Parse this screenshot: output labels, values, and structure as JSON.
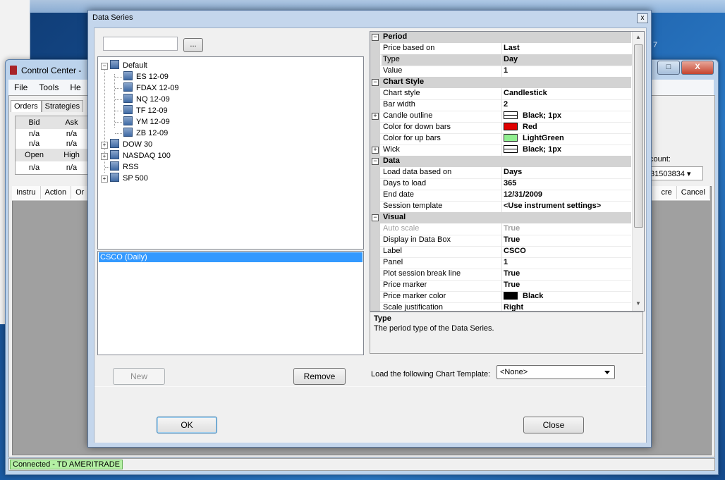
{
  "desktop": {
    "corner_text": "7"
  },
  "control_center": {
    "title": "Control Center -",
    "window_buttons": {
      "min": "–",
      "max": "□",
      "close": "X"
    },
    "menu": [
      "File",
      "Tools",
      "He"
    ],
    "tabs": [
      "Orders",
      "Strategies"
    ],
    "quote_headers_1": [
      "Bid",
      "Ask"
    ],
    "quote_values_1a": [
      "n/a",
      "n/a"
    ],
    "quote_values_1b": [
      "n/a",
      "n/a"
    ],
    "quote_headers_2": [
      "Open",
      "High"
    ],
    "quote_values_2": [
      "n/a",
      "n/a"
    ],
    "order_columns_left": [
      "Instru",
      "Action",
      "Or"
    ],
    "order_columns_right": [
      "cre",
      "Cancel"
    ],
    "account_label": "count:",
    "account_value": "31503834",
    "status": "Connected - TD AMERITRADE"
  },
  "dialog": {
    "title": "Data Series",
    "close": "x",
    "browse_label": "...",
    "tree": {
      "default_group": "Default",
      "default_children": [
        "ES 12-09",
        "FDAX 12-09",
        "NQ 12-09",
        "TF 12-09",
        "YM 12-09",
        "ZB 12-09"
      ],
      "groups": [
        "DOW 30",
        "NASDAQ 100",
        "RSS",
        "SP 500"
      ]
    },
    "series_selected": "CSCO (Daily)",
    "buttons": {
      "new": "New",
      "remove": "Remove",
      "ok": "OK",
      "close": "Close"
    },
    "properties": {
      "period": {
        "label": "Period",
        "rows": [
          [
            "Price based on",
            "Last"
          ],
          [
            "Type",
            "Day"
          ],
          [
            "Value",
            "1"
          ]
        ]
      },
      "chart_style": {
        "label": "Chart Style",
        "rows": [
          [
            "Chart style",
            "Candlestick"
          ],
          [
            "Bar width",
            "2"
          ],
          [
            "Candle outline",
            "Black; 1px"
          ],
          [
            "Color for down bars",
            "Red"
          ],
          [
            "Color for up bars",
            "LightGreen"
          ],
          [
            "Wick",
            "Black; 1px"
          ]
        ]
      },
      "data": {
        "label": "Data",
        "rows": [
          [
            "Load data based on",
            "Days"
          ],
          [
            "Days to load",
            "365"
          ],
          [
            "End date",
            "12/31/2009"
          ],
          [
            "Session template",
            "<Use instrument settings>"
          ]
        ]
      },
      "visual": {
        "label": "Visual",
        "rows": [
          [
            "Auto scale",
            "True"
          ],
          [
            "Display in Data Box",
            "True"
          ],
          [
            "Label",
            "CSCO"
          ],
          [
            "Panel",
            "1"
          ],
          [
            "Plot session break line",
            "True"
          ],
          [
            "Price marker",
            "True"
          ],
          [
            "Price marker color",
            "Black"
          ],
          [
            "Scale justification",
            "Right"
          ]
        ]
      }
    },
    "colors": {
      "down_bars": "#e00000",
      "up_bars": "#90ee90",
      "marker": "#000000",
      "selection": "#3399ff"
    },
    "help": {
      "title": "Type",
      "description": "The period type of the Data Series."
    },
    "template_label": "Load the following Chart Template:",
    "template_value": "<None>"
  }
}
